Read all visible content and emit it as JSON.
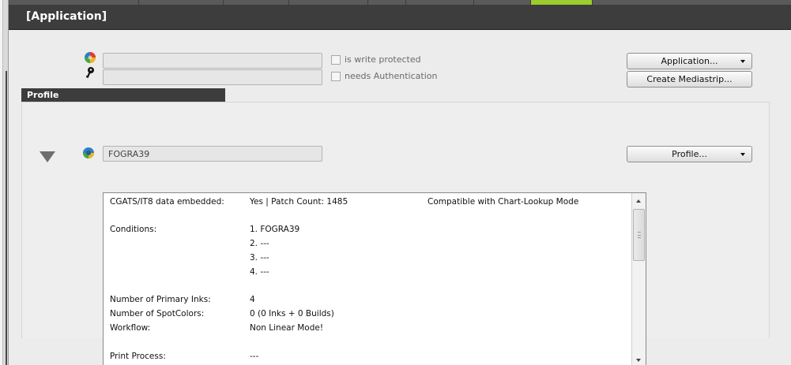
{
  "header": {
    "title": "[Application]"
  },
  "application": {
    "name_value": "",
    "auth_value": "",
    "write_protected_label": "is write protected",
    "needs_auth_label": "needs Authentication",
    "application_button": "Application...",
    "create_mediastrip_button": "Create Mediastrip..."
  },
  "profile": {
    "section_label": "Profile",
    "name_value": "FOGRA39",
    "profile_button": "Profile...",
    "info": {
      "cgats_label": "CGATS/IT8 data embedded:",
      "cgats_value": "Yes | Patch Count: 1485",
      "cgats_note": "Compatible with Chart-Lookup Mode",
      "conditions_label": "Conditions:",
      "conditions": [
        "1. FOGRA39",
        "2. ---",
        "3. ---",
        "4. ---"
      ],
      "primary_inks_label": "Number of Primary Inks:",
      "primary_inks_value": "4",
      "spotcolors_label": "Number of SpotColors:",
      "spotcolors_value": "0  (0 Inks + 0 Builds)",
      "workflow_label": "Workflow:",
      "workflow_value": "Non Linear Mode!",
      "print_process_label": "Print Process:",
      "print_process_value": "---"
    }
  },
  "colors": {
    "header_bg": "#3d3d3d",
    "active_tab": "#9ccc2e",
    "panel_bg": "#ececec"
  },
  "icons": {
    "app_icon": "color-wheel-icon",
    "key_icon": "key-icon",
    "profile_icon": "profile-swirl-icon",
    "collapse_icon": "collapse-triangle-icon"
  }
}
